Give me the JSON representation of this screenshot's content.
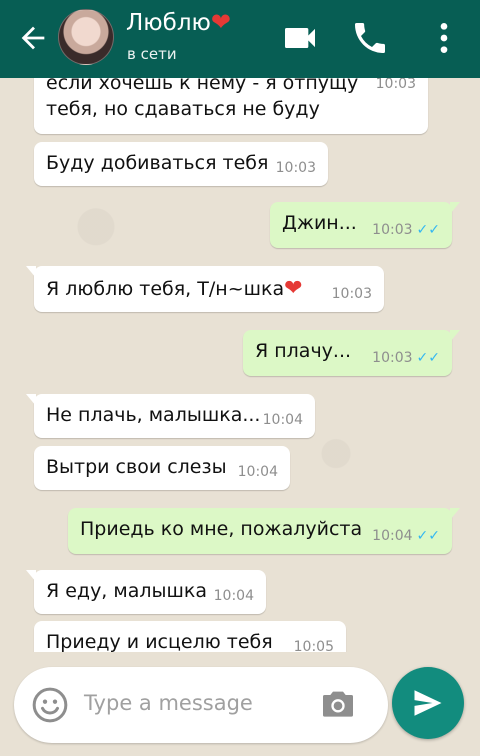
{
  "header": {
    "contact_name": "Люблю",
    "heart": "❤",
    "status": "в сети"
  },
  "messages": [
    {
      "direction": "in",
      "text_line1": "если хочешь к нему - я отпущу",
      "text_line2": "тебя, но сдаваться не буду",
      "time": "10:03"
    },
    {
      "direction": "in",
      "text": "Буду добиваться тебя",
      "time": "10:03"
    },
    {
      "direction": "out",
      "text": "Джин...",
      "time": "10:03",
      "read": true
    },
    {
      "direction": "in",
      "text": "Я люблю тебя, Т/н~шка",
      "emoji": "❤",
      "time": "10:03"
    },
    {
      "direction": "out",
      "text": "Я плачу...",
      "time": "10:03",
      "read": true
    },
    {
      "direction": "in",
      "text": "Не плачь, малышка...",
      "time": "10:04"
    },
    {
      "direction": "in",
      "text": "Вытри свои слезы",
      "time": "10:04"
    },
    {
      "direction": "out",
      "text": "Приедь ко мне, пожалуйста",
      "time": "10:04",
      "read": true
    },
    {
      "direction": "in",
      "text": "Я еду, малышка",
      "time": "10:04"
    },
    {
      "direction": "in",
      "text": "Приеду и исцелю тебя",
      "time": "10:05"
    }
  ],
  "composer": {
    "placeholder": "Type a message"
  },
  "colors": {
    "header": "#075e54",
    "outgoing_bubble": "#dcf8c6",
    "incoming_bubble": "#ffffff",
    "read_ticks": "#34b7f1",
    "send_button": "#128c7e"
  }
}
